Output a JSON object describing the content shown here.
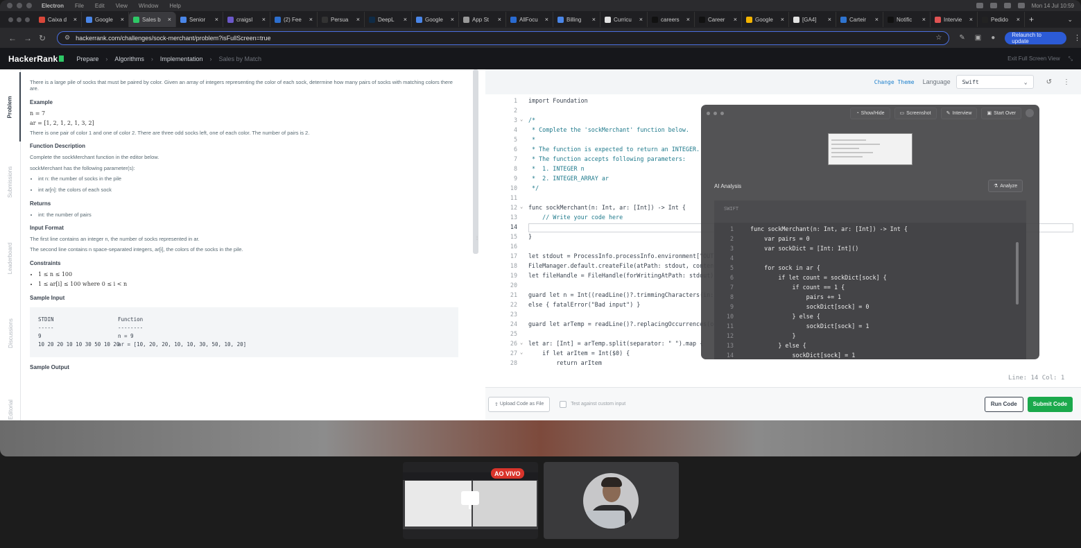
{
  "menubar": {
    "app": "Electron",
    "items": [
      "File",
      "Edit",
      "View",
      "Window",
      "Help"
    ],
    "clock": "Mon 14 Jul 10:59"
  },
  "tabs": [
    {
      "label": "Caixa d",
      "color": "#d9473a"
    },
    {
      "label": "Google",
      "color": "#4a86e8"
    },
    {
      "label": "Sales b",
      "color": "#2ec866",
      "active": true
    },
    {
      "label": "Senior",
      "color": "#4a86e8"
    },
    {
      "label": "craigsl",
      "color": "#6b58c9"
    },
    {
      "label": "(2) Fee",
      "color": "#2d6fcf"
    },
    {
      "label": "Persua",
      "color": "#333333"
    },
    {
      "label": "DeepL",
      "color": "#0f2b46"
    },
    {
      "label": "Google",
      "color": "#4a86e8"
    },
    {
      "label": "App St",
      "color": "#999999"
    },
    {
      "label": "AllFocu",
      "color": "#2a6bd1"
    },
    {
      "label": "Billing",
      "color": "#4a86e8"
    },
    {
      "label": "Curricu",
      "color": "#e2e2e2"
    },
    {
      "label": "careers",
      "color": "#111111"
    },
    {
      "label": "Career",
      "color": "#111111"
    },
    {
      "label": "Google",
      "color": "#f4b400"
    },
    {
      "label": "[GA4]",
      "color": "#e2e2e2"
    },
    {
      "label": "Carteir",
      "color": "#2f74d0"
    },
    {
      "label": "Notific",
      "color": "#111111"
    },
    {
      "label": "Intervie",
      "color": "#e05353"
    },
    {
      "label": "Pedido",
      "color": "#222222"
    }
  ],
  "browser": {
    "url": "hackerrank.com/challenges/sock-merchant/problem?isFullScreen=true",
    "relaunch": "Relaunch to update"
  },
  "hr": {
    "logo": "HackerRank",
    "breadcrumb": [
      "Prepare",
      "Algorithms",
      "Implementation",
      "Sales by Match"
    ],
    "exit": "Exit Full Screen View"
  },
  "sidetabs": [
    "Problem",
    "Submissions",
    "Leaderboard",
    "Discussions",
    "Editorial"
  ],
  "problem": {
    "intro": "There is a large pile of socks that must be paired by color. Given an array of integers representing the color of each sock, determine how many pairs of socks with matching colors there are.",
    "example_h": "Example",
    "ex1": "n = 7",
    "ex2": "ar = [1, 2, 1, 2, 1, 3, 2]",
    "ex_text": "There is one pair of color 1 and one of color 2. There are three odd socks left, one of each color. The number of pairs is 2.",
    "fd_h": "Function Description",
    "fd1": "Complete the sockMerchant function in the editor below.",
    "fd2": "sockMerchant has the following parameter(s):",
    "params": [
      "int n: the number of socks in the pile",
      "int ar[n]: the colors of each sock"
    ],
    "ret_h": "Returns",
    "ret": [
      "int: the number of pairs"
    ],
    "in_h": "Input Format",
    "in1": "The first line contains an integer n, the number of socks represented in ar.",
    "in2": "The second line contains n space-separated integers, ar[i], the colors of the socks in the pile.",
    "con_h": "Constraints",
    "cons": [
      "1 ≤ n ≤ 100",
      "1 ≤ ar[i] ≤ 100 where 0 ≤ i < n"
    ],
    "si_h": "Sample Input",
    "sample": [
      [
        "STDIN",
        "Function"
      ],
      [
        "-----",
        "--------"
      ],
      [
        "9",
        "n = 9"
      ],
      [
        "10 20 20 10 10 30 50 10 20",
        "ar = [10, 20, 20, 10, 10, 30, 50, 10, 20]"
      ]
    ],
    "so_h": "Sample Output"
  },
  "editor": {
    "change_theme": "Change Theme",
    "language_label": "Language",
    "language": "Swift",
    "lines": [
      "import Foundation",
      "",
      "/*",
      " * Complete the 'sockMerchant' function below.",
      " *",
      " * The function is expected to return an INTEGER.",
      " * The function accepts following parameters:",
      " *  1. INTEGER n",
      " *  2. INTEGER_ARRAY ar",
      " */",
      "",
      "func sockMerchant(n: Int, ar: [Int]) -> Int {",
      "    // Write your code here",
      "",
      "}",
      "",
      "let stdout = ProcessInfo.processInfo.environment[\"OUTPUT_PATH\"]!",
      "FileManager.default.createFile(atPath: stdout, contents: nil, attributes: nil)",
      "let fileHandle = FileHandle(forWritingAtPath: stdout)!",
      "",
      "guard let n = Int((readLine()?.trimmingCharacters(in: .whitespacesAndNewlines))!)",
      "else { fatalError(\"Bad input\") }",
      "",
      "guard let arTemp = readLine()?.replacingOccurrences(of: \"\\\\s+$\", with: \"\", options: .regularExpression) else { fatalError(\"Bad input\") }",
      "",
      "let ar: [Int] = arTemp.split(separator: \" \").map {",
      "    if let arItem = Int($0) {",
      "        return arItem"
    ],
    "status": "Line: 14 Col: 1",
    "upload": "Upload Code as File",
    "custom": "Test against custom input",
    "run": "Run Code",
    "submit": "Submit Code"
  },
  "overlay": {
    "buttons": [
      "Show/Hide",
      "Screenshot",
      "Interview",
      "Start Over"
    ],
    "ai_title": "AI Analysis",
    "analyze": "Analyze",
    "lang": "SWIFT",
    "code": [
      "func sockMerchant(n: Int, ar: [Int]) -> Int {",
      "    var pairs = 0",
      "    var sockDict = [Int: Int]()",
      "",
      "    for sock in ar {",
      "        if let count = sockDict[sock] {",
      "            if count == 1 {",
      "                pairs += 1",
      "                sockDict[sock] = 0",
      "            } else {",
      "                sockDict[sock] = 1",
      "            }",
      "        } else {",
      "            sockDict[sock] = 1"
    ]
  },
  "meeting": {
    "live": "AO VIVO"
  }
}
